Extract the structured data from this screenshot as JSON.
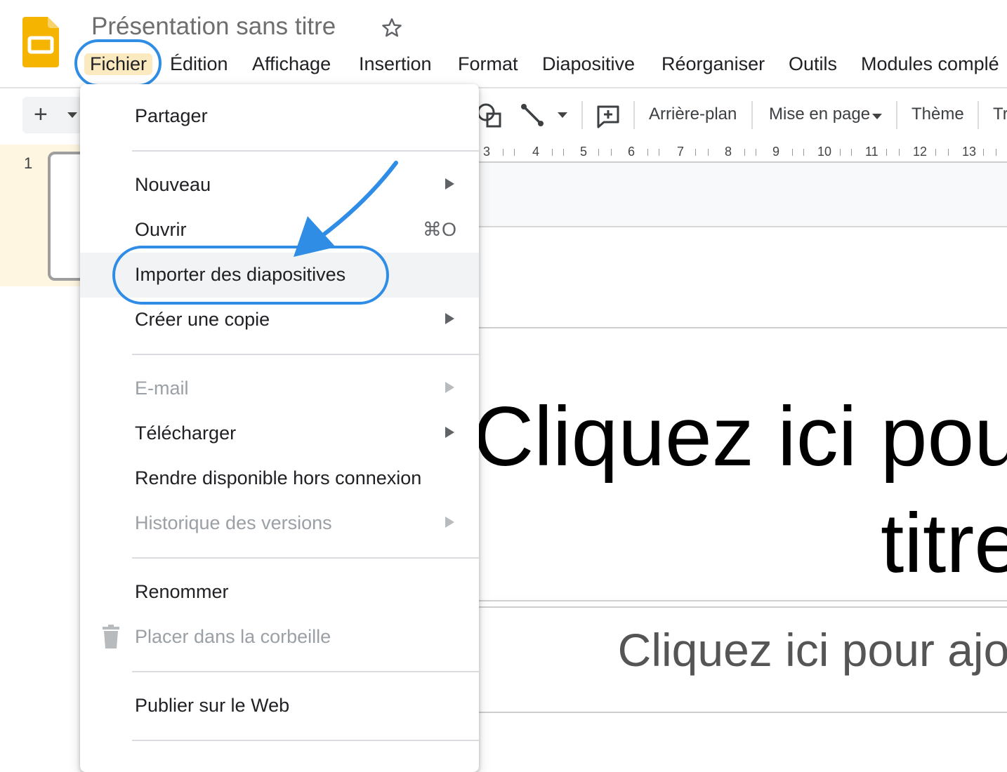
{
  "header": {
    "doc_title": "Présentation sans titre"
  },
  "menubar": {
    "items": [
      "Fichier",
      "Édition",
      "Affichage",
      "Insertion",
      "Format",
      "Diapositive",
      "Réorganiser",
      "Outils",
      "Modules complé"
    ]
  },
  "toolbar": {
    "background": "Arrière-plan",
    "layout": "Mise en page",
    "theme": "Thème",
    "transition_partial": "Tr"
  },
  "ruler": {
    "numbers": [
      "3",
      "4",
      "5",
      "6",
      "7",
      "8",
      "9",
      "10",
      "11",
      "12",
      "13"
    ]
  },
  "filmstrip": {
    "slide_number": "1"
  },
  "slide": {
    "title_line1": "Cliquez ici pou",
    "title_line2": "titre",
    "subtitle": "Cliquez ici pour ajou"
  },
  "file_menu": {
    "items": [
      {
        "label": "Partager"
      },
      {
        "label": "Nouveau"
      },
      {
        "label": "Ouvrir",
        "shortcut": "⌘O"
      },
      {
        "label": "Importer des diapositives"
      },
      {
        "label": "Créer une copie"
      },
      {
        "label": "E-mail"
      },
      {
        "label": "Télécharger"
      },
      {
        "label": "Rendre disponible hors connexion"
      },
      {
        "label": "Historique des versions"
      },
      {
        "label": "Renommer"
      },
      {
        "label": "Placer dans la corbeille"
      },
      {
        "label": "Publier sur le Web"
      }
    ]
  },
  "colors": {
    "accent_ring": "#2f8de6",
    "app_icon": "#f4b400",
    "active_menu_bg": "#fbe9c0",
    "hover_bg": "#f1f3f4"
  },
  "icons": [
    "slides-app-icon",
    "star-icon",
    "plus-icon",
    "chevron-down-icon",
    "shape-icon",
    "line-icon",
    "add-comment-icon",
    "trash-icon",
    "pointer-arrow"
  ]
}
